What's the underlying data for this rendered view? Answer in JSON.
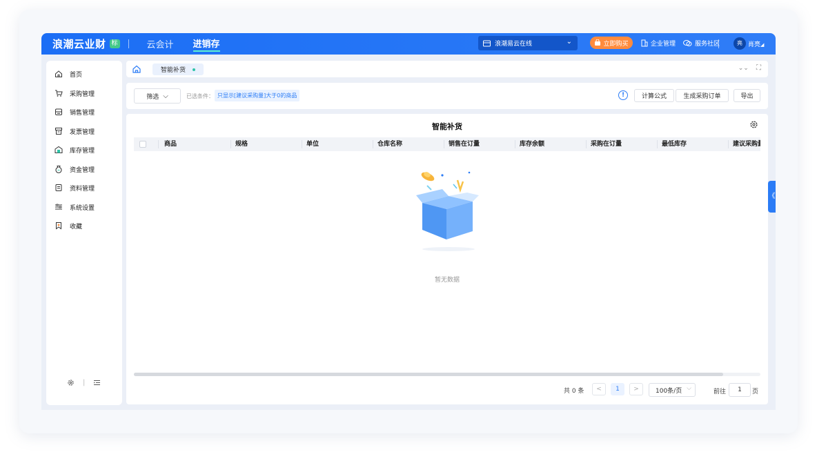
{
  "topbar": {
    "brand": "浪潮云业财",
    "brand_tag": "标",
    "nav_tabs": [
      "云会计",
      "进销存"
    ],
    "company": "浪潮易云在线",
    "buy_label": "立即购买",
    "enterprise_label": "企业管理",
    "community_label": "服务社区",
    "avatar_text": "亮",
    "user_name": "肖亮"
  },
  "sidebar": {
    "items": [
      {
        "label": "首页",
        "icon": "home-icon"
      },
      {
        "label": "采购管理",
        "icon": "cart-icon"
      },
      {
        "label": "销售管理",
        "icon": "register-icon"
      },
      {
        "label": "发票管理",
        "icon": "invoice-icon"
      },
      {
        "label": "库存管理",
        "icon": "warehouse-icon"
      },
      {
        "label": "资金管理",
        "icon": "moneybag-icon"
      },
      {
        "label": "资料管理",
        "icon": "document-icon"
      },
      {
        "label": "系统设置",
        "icon": "sliders-icon"
      },
      {
        "label": "收藏",
        "icon": "bookmark-icon"
      }
    ],
    "footer_sep": "|"
  },
  "breadcrumb": {
    "tab_label": "智能补货",
    "collapse_symbol": "⌄⌄",
    "fullscreen_symbol": "⛶"
  },
  "filter": {
    "filter_label": "筛选",
    "condition_label": "已选条件：",
    "condition_tag": "只显示[建议采购量]大于0的商品",
    "info_symbol": "!",
    "formula_label": "计算公式",
    "generate_order_label": "生成采购订单",
    "export_label": "导出"
  },
  "panel": {
    "title": "智能补货",
    "columns": [
      "商品",
      "规格",
      "单位",
      "仓库名称",
      "销售在订量",
      "库存余额",
      "采购在订量",
      "最低库存",
      "建议采购量"
    ],
    "empty_text": "暂无数据"
  },
  "pagination": {
    "total_text": "共 0 条",
    "prev_symbol": "<",
    "current_page": "1",
    "next_symbol": ">",
    "page_size": "100条/页",
    "goto_label": "前往",
    "goto_value": "1",
    "page_suffix": "页"
  },
  "colors": {
    "primary": "#2b7cf6",
    "topbar": "#1b6ef5",
    "buy": "#ff8b3d",
    "accent_green": "#2ec4a8"
  }
}
